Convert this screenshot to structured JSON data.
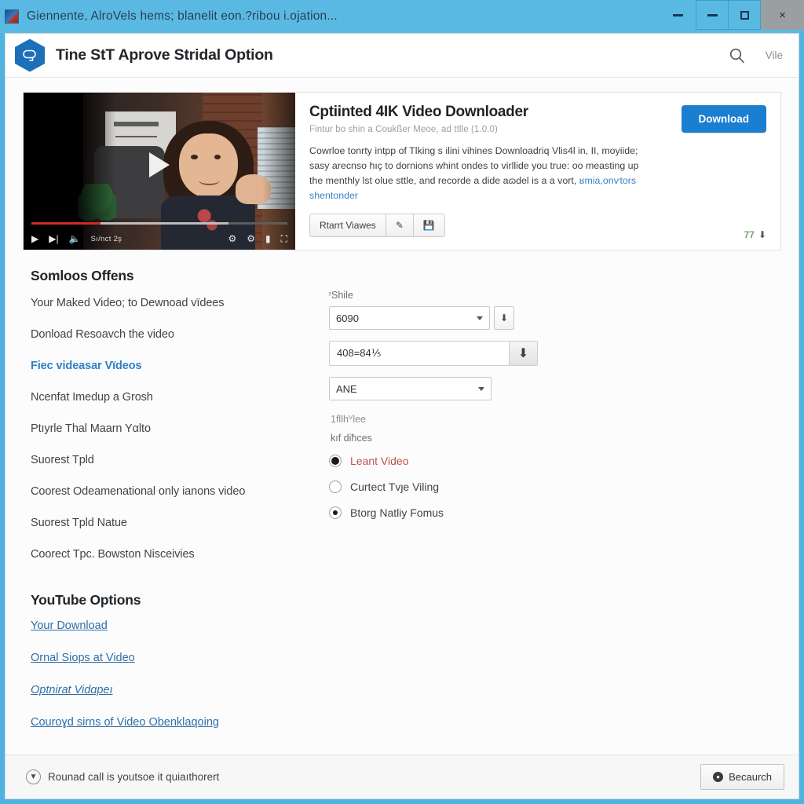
{
  "window": {
    "title": "Giennente, AlroVels hems; blanelit eon.?ribou i.ojation...",
    "titlebar_color": "#5ab9e3",
    "controls": {
      "minimize_extra": "minimize-extra",
      "minimize": "minimize",
      "maximize": "maximize",
      "close": "×"
    }
  },
  "header": {
    "app_title": "Tine StT Aprove Stridal Option",
    "search_icon": "search-icon",
    "right_link": "Vile",
    "logo_icon": "app-logo-hexagon-icon"
  },
  "card": {
    "title": "Cptiinted 4IK Video Downloader",
    "subtitle": "Fintur bo shin a Coukßer Meoe, ad ttlle (1.0.0)",
    "description": "Cowrloe tonrty intpp of Tlking s ilini vihines Downloadriq Vlis4l in, II, moyiide; sasy arecnso hıç to dornions whint ondes to virllide you true: oo measting up the menthly lst olue sttle, and recorde a dide aɷdel is a a vort,",
    "description_link": "ʁmia,onѵtors shentonder",
    "download_button": "Download",
    "download_button_color": "#1a7fd0",
    "action_button": "Rtarrt Viawes",
    "action_icon_edit": "pencil-icon",
    "action_icon_save": "save-download-icon",
    "download_count": "77",
    "download_count_icon": "download-icon",
    "download_count_color": "#6fa66f"
  },
  "player": {
    "play_big_icon": "play-button-large-icon",
    "play_icon": "play-icon",
    "next_icon": "next-track-icon",
    "volume_icon": "volume-icon",
    "time": "Sı/nct 2ş",
    "settings_icon": "settings-gear-icon",
    "gear_icon": "gear-icon",
    "theater_icon": "theater-mode-icon",
    "fullscreen_icon": "fullscreen-icon",
    "progress_played_pct": 27,
    "progress_buffered_pct": 77,
    "progress_color": "#cf2b23"
  },
  "options": {
    "section_title": "Somloos Offens",
    "items": [
      {
        "label": "Your Maked Video; to Dewnoad vïdees",
        "highlight": false
      },
      {
        "label": "Donload Resoavch the video",
        "highlight": false
      },
      {
        "label": "Fiec videasar Vïdeos",
        "highlight": true
      },
      {
        "label": "Ncenfat Imedup a Grosh",
        "highlight": false
      },
      {
        "label": "Ptıyrle Thal Maarn Yαlto",
        "highlight": false
      },
      {
        "label": "Suorest Tpld",
        "highlight": false
      },
      {
        "label": "Coorest Odeamenational only ianons video",
        "highlight": false
      },
      {
        "label": "Suorest Tpld Natue",
        "highlight": false
      },
      {
        "label": "Coorect Tpc. Bowston Nisceivies",
        "highlight": false
      }
    ],
    "form": {
      "field_label": "ʳShile",
      "select_quality": "6090",
      "select_quality_icon": "download-small-icon",
      "text_value": "408=84⅕",
      "text_button_icon": "download-arrow-icon",
      "select_format": "ANE",
      "note_1": "1fllhⱽlee",
      "note_2": "kıf diħces"
    },
    "radios": [
      {
        "label": "Leant Video",
        "state": "filled",
        "accent": true
      },
      {
        "label": "Curtect Tvȷe Viling",
        "state": "empty",
        "accent": false
      },
      {
        "label": "Btorɡ Natliy Fomus",
        "state": "dot",
        "accent": false
      }
    ],
    "radio_accent_color": "#c0504d"
  },
  "youtube": {
    "section_title": "YouTube Options",
    "links": [
      {
        "label": "Your Download",
        "italic": false
      },
      {
        "label": "Ornal Siops at Video",
        "italic": false
      },
      {
        "label": "Optnirat Vidɑрeı",
        "italic": true
      },
      {
        "label": "Couroɣd sirns of Video Obenklaqoing",
        "italic": false
      }
    ],
    "link_color": "#2f6fa8"
  },
  "status": {
    "icon": "info-circle-icon",
    "message": "Rounad call is youtsoe it quiaıthorert",
    "button_label": "Becaurch",
    "button_icon": "clock-icon"
  }
}
